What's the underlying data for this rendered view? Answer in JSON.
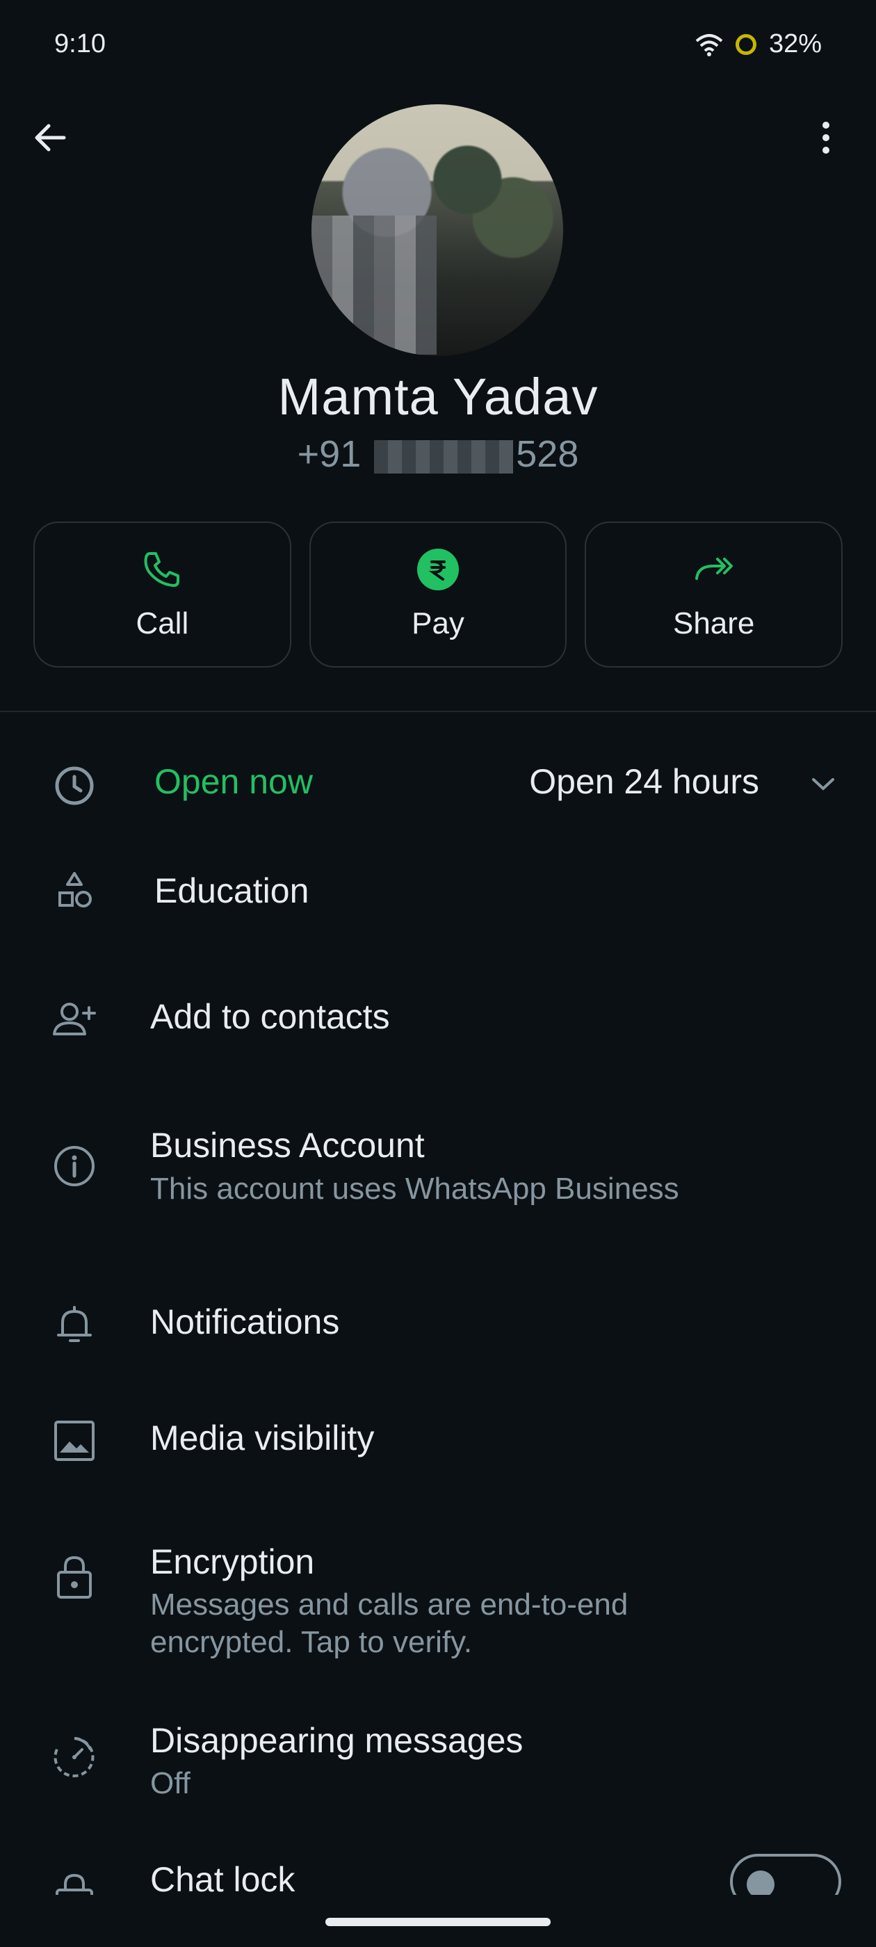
{
  "status_bar": {
    "time": "9:10",
    "battery": "32%"
  },
  "contact": {
    "name": "Mamta Yadav",
    "phone_prefix": "+91",
    "phone_suffix": "528"
  },
  "actions": [
    {
      "label": "Call",
      "icon": "phone-icon"
    },
    {
      "label": "Pay",
      "icon": "rupee-icon"
    },
    {
      "label": "Share",
      "icon": "share-icon"
    }
  ],
  "hours": {
    "status": "Open now",
    "hours": "Open 24 hours"
  },
  "category": "Education",
  "add_contacts": "Add to contacts",
  "business": {
    "title": "Business Account",
    "subtitle": "This account uses WhatsApp Business"
  },
  "notifications": "Notifications",
  "media": "Media visibility",
  "encryption": {
    "title": "Encryption",
    "subtitle_line1": "Messages and calls are end-to-end",
    "subtitle_line2": "encrypted. Tap to verify."
  },
  "disappearing": {
    "title": "Disappearing messages",
    "value": "Off"
  },
  "chat_lock": {
    "title": "Chat lock",
    "enabled": false
  },
  "colors": {
    "accent": "#21c063",
    "background": "#0b1014",
    "muted": "#8696a0"
  }
}
